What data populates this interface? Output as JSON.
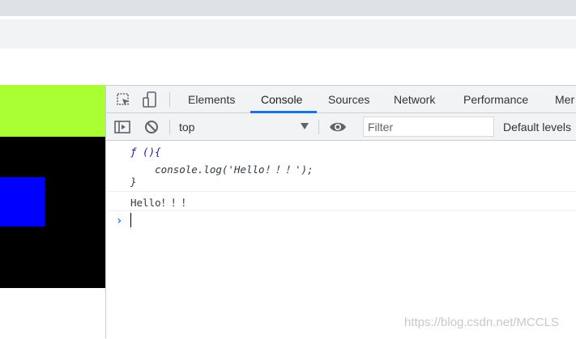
{
  "devtools": {
    "tabs": [
      {
        "label": "Elements"
      },
      {
        "label": "Console"
      },
      {
        "label": "Sources"
      },
      {
        "label": "Network"
      },
      {
        "label": "Performance"
      },
      {
        "label": "Mer"
      }
    ],
    "active_tab": "Console",
    "toolbar": {
      "context": "top",
      "filter_placeholder": "Filter",
      "levels": "Default levels"
    },
    "icons": [
      "inspect-element-icon",
      "device-toolbar-icon",
      "sidebar-toggle-icon",
      "clear-console-icon",
      "eye-icon"
    ],
    "accent_color": "#1a73e8"
  },
  "console": {
    "function_line1": "ƒ (){",
    "function_line2": "    console.log('Hello！！！');",
    "function_line3": "}",
    "log_output": "Hello！！！"
  },
  "page": {
    "colors": [
      "#aaff33",
      "#000000",
      "#0000ff"
    ]
  },
  "watermark": "https://blog.csdn.net/MCCLS"
}
